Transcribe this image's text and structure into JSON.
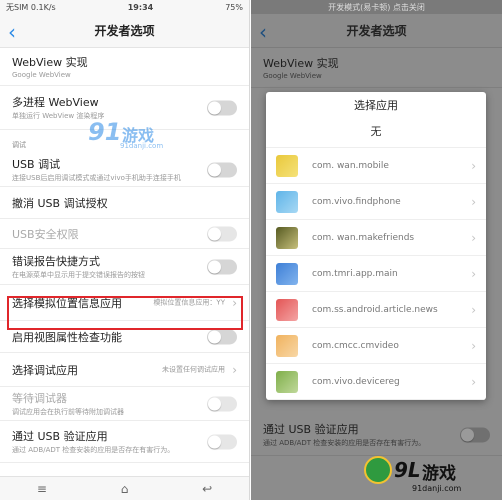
{
  "left": {
    "status": {
      "carrier": "无SIM 0.1K/s",
      "time": "19:34",
      "battery": "75%"
    },
    "title": "开发者选项",
    "rows": [
      {
        "title": "WebView 实现",
        "sub": "Google WebView"
      },
      {
        "title": "多进程 WebView",
        "sub": "单独运行 WebView 渲染程序"
      },
      {
        "title": "USB 调试",
        "sub": "连接USB后启用调试模式或通过vivo手机助手连接手机"
      },
      {
        "title": "撤消 USB 调试授权"
      },
      {
        "title": "USB安全权限"
      },
      {
        "title": "错误报告快捷方式",
        "sub": "在电源菜单中显示用于提交错误报告的按钮"
      },
      {
        "title": "选择模拟位置信息应用",
        "value": "模拟位置信息应用：YY"
      },
      {
        "title": "启用视图属性检查功能"
      },
      {
        "title": "选择调试应用",
        "value": "未设置任何调试应用"
      },
      {
        "title": "等待调试器",
        "sub": "调试应用会在执行前等待附加调试器"
      },
      {
        "title": "通过 USB 验证应用",
        "sub": "通过 ADB/ADT 检查安装的应用是否存在有害行为。"
      }
    ],
    "section": "调试",
    "watermark": {
      "num": "91",
      "cn": "游戏",
      "url": "91danji.com"
    }
  },
  "right": {
    "status": {
      "text": "开发模式(易卡顿)  点击关闭"
    },
    "title": "开发者选项",
    "bg_rows": [
      {
        "title": "WebView 实现",
        "sub": "Google WebView"
      },
      {
        "title": "通过 USB 验证应用",
        "sub": "通过 ADB/ADT 检查安装的应用是否存在有害行为。"
      }
    ],
    "dialog": {
      "title": "选择应用",
      "none": "无",
      "apps": [
        {
          "name": "com.   wan.mobile",
          "colors": [
            "#e9c83b",
            "#f5e27a"
          ]
        },
        {
          "name": "com.vivo.findphone",
          "colors": [
            "#5fb4e8",
            "#a7d8f4"
          ]
        },
        {
          "name": "com.   wan.makefriends",
          "colors": [
            "#565a22",
            "#c7c07c"
          ]
        },
        {
          "name": "com.tmri.app.main",
          "colors": [
            "#3e7fd6",
            "#82b4ee"
          ]
        },
        {
          "name": "com.ss.android.article.news",
          "colors": [
            "#e35555",
            "#f4a4a4"
          ]
        },
        {
          "name": "com.cmcc.cmvideo",
          "colors": [
            "#f0b25e",
            "#f8d7a6"
          ]
        },
        {
          "name": "com.vivo.devicereg",
          "colors": [
            "#7fae4a",
            "#c0d99b"
          ]
        }
      ]
    },
    "brand": {
      "num": "9L",
      "cn": "游戏",
      "url": "91danji.com"
    }
  },
  "colors": {
    "accent": "#2b8ae6",
    "highlight": "#e0262b"
  }
}
